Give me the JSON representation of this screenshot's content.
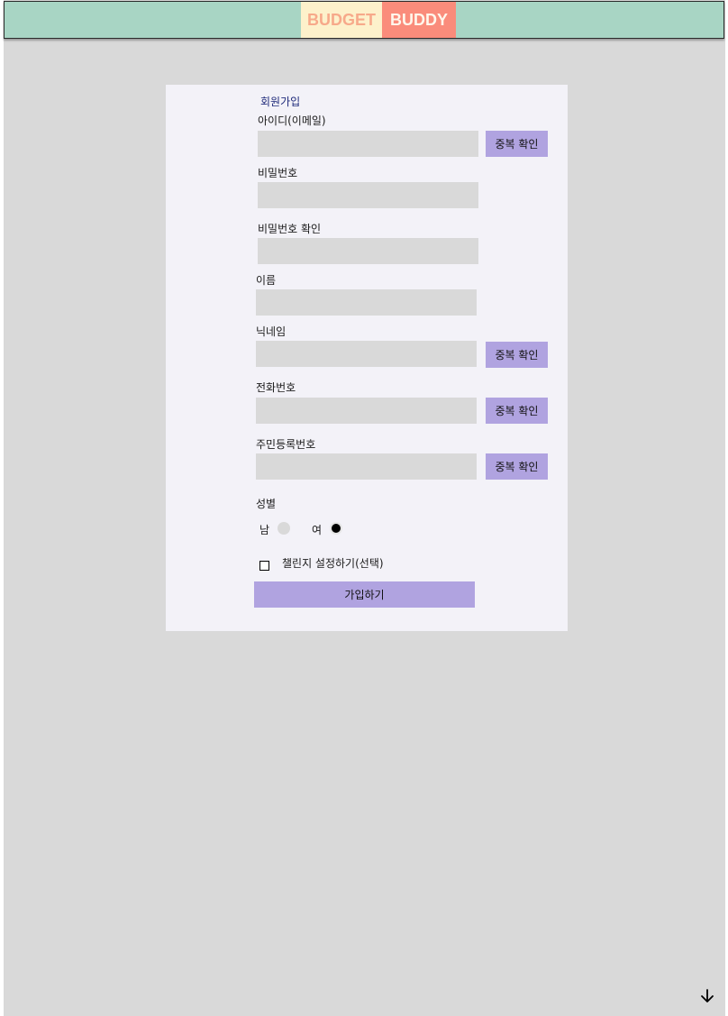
{
  "header": {
    "logo_part1": "BUDGET",
    "logo_part2": "BUDDY"
  },
  "form": {
    "title": "회원가입",
    "id_label": "아이디(이메일)",
    "password_label": "비밀번호",
    "password_confirm_label": "비밀번호 확인",
    "name_label": "이름",
    "nickname_label": "닉네임",
    "phone_label": "전화번호",
    "resident_label": "주민등록번호",
    "dup_check_label": "중복 확인",
    "gender_label": "성별",
    "gender_male": "남",
    "gender_female": "여",
    "gender_selected": "여",
    "challenge_label": "챌린지 설정하기(선택)",
    "submit_label": "가입하기"
  },
  "icons": {
    "scroll": "arrow-down-icon"
  },
  "colors": {
    "header_bg": "#a8d5c4",
    "logo_part1_bg": "#fdf1cb",
    "logo_part1_text": "#f7a98a",
    "logo_part2_bg": "#fa8c7b",
    "logo_part2_text": "#fff7ec",
    "page_bg": "#d9d9d9",
    "card_bg": "#f3f2f8",
    "accent": "#b0a3e0"
  }
}
